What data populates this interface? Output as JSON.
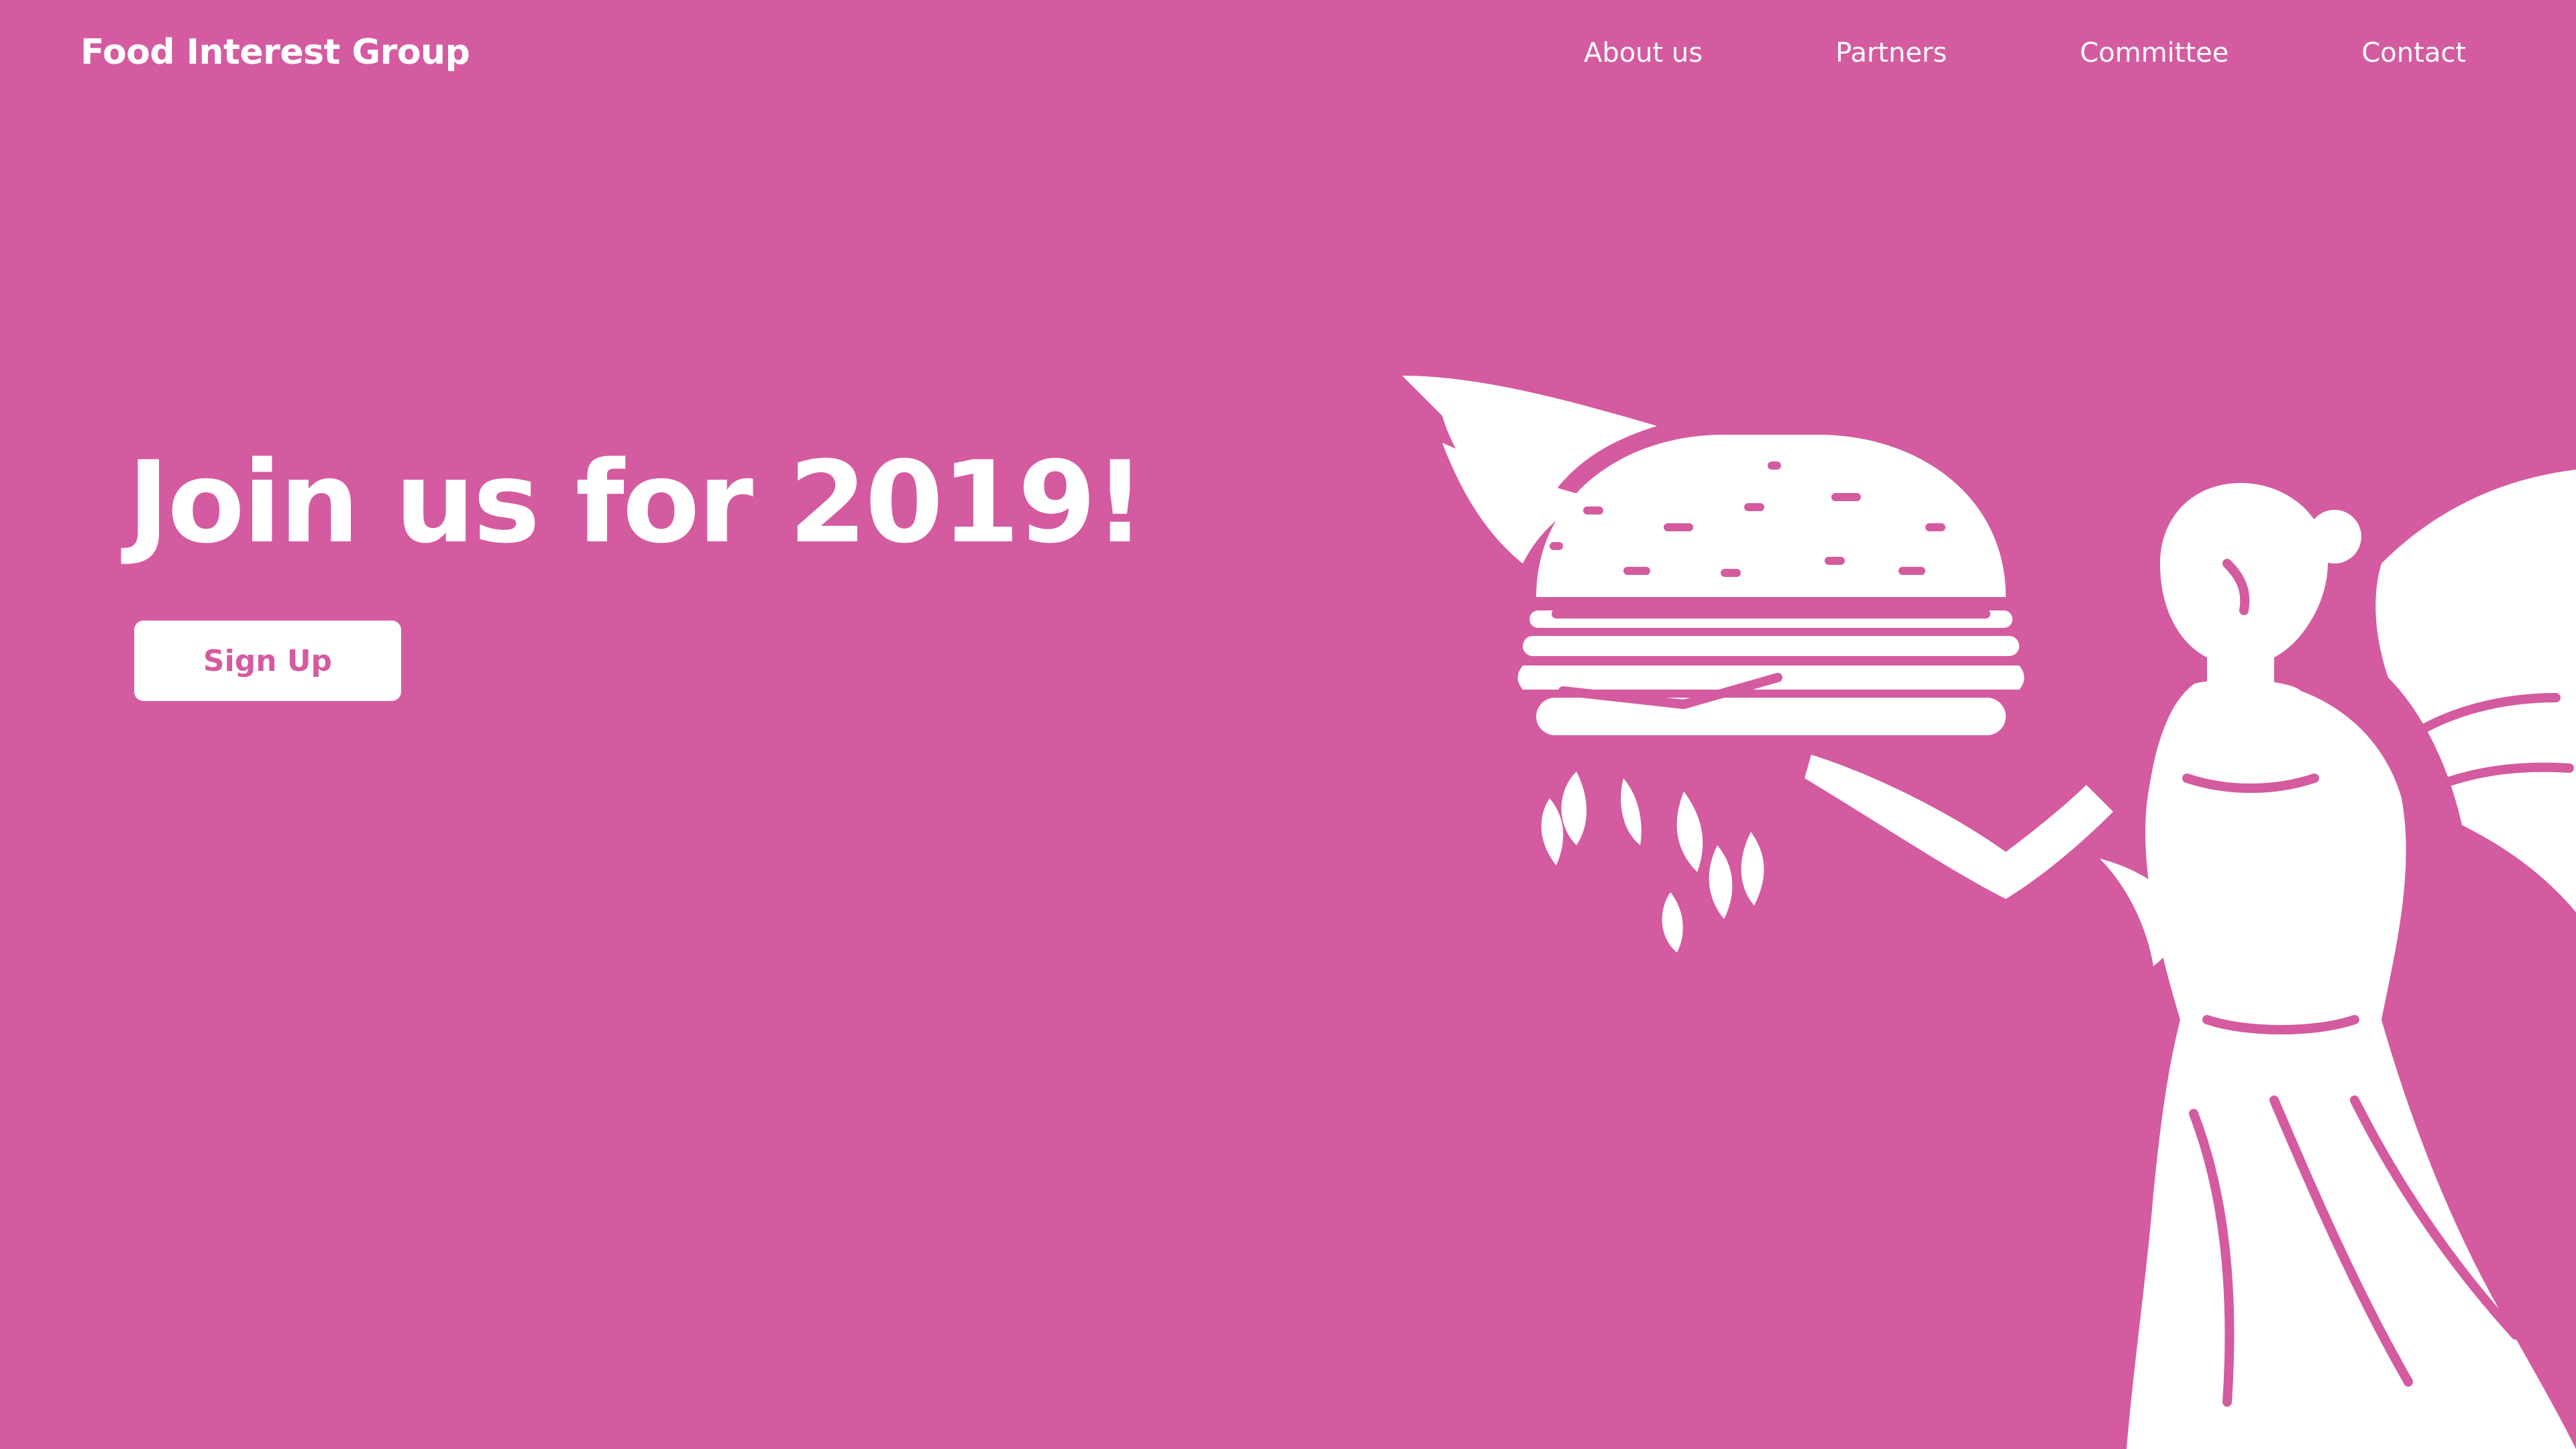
{
  "header": {
    "brand": "Food Interest Group",
    "nav": [
      {
        "label": "About us"
      },
      {
        "label": "Partners"
      },
      {
        "label": "Committee"
      },
      {
        "label": "Contact"
      }
    ]
  },
  "hero": {
    "headline": "Join us for 2019!",
    "cta_label": "Sign Up",
    "illustration_icon": "winged-angel-holding-burger-icon"
  },
  "colors": {
    "background": "#d45ba0",
    "foreground": "#ffffff"
  }
}
